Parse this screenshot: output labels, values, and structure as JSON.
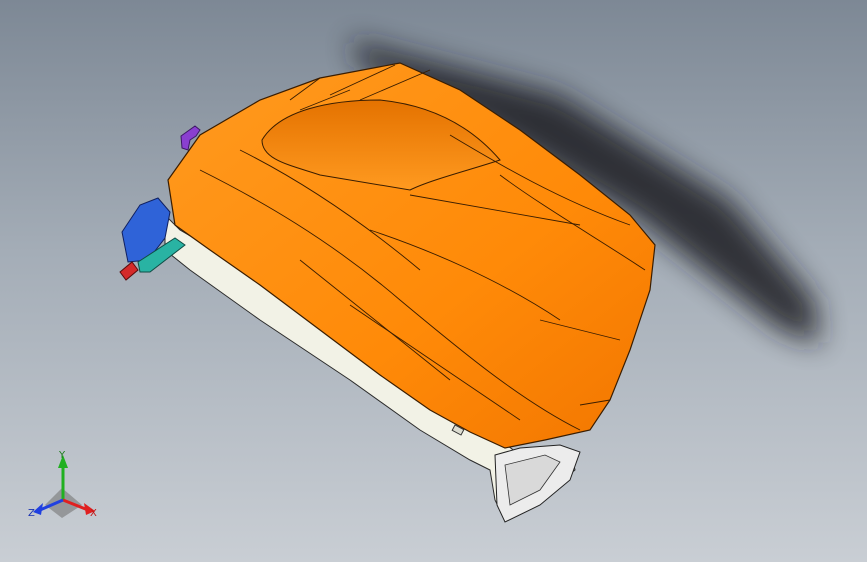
{
  "triad": {
    "x_label": "X",
    "y_label": "Y",
    "z_label": "Z"
  },
  "colors": {
    "part_body": "#ff8c0a",
    "part_edge": "#3a1d00",
    "frame": "#f2f2e8",
    "bracket_blue": "#2f63d8",
    "bracket_teal": "#29b3a3",
    "clip_purple": "#8a3fd0",
    "axis_x": "#e02020",
    "axis_y": "#20b020",
    "axis_z": "#2040e0"
  }
}
